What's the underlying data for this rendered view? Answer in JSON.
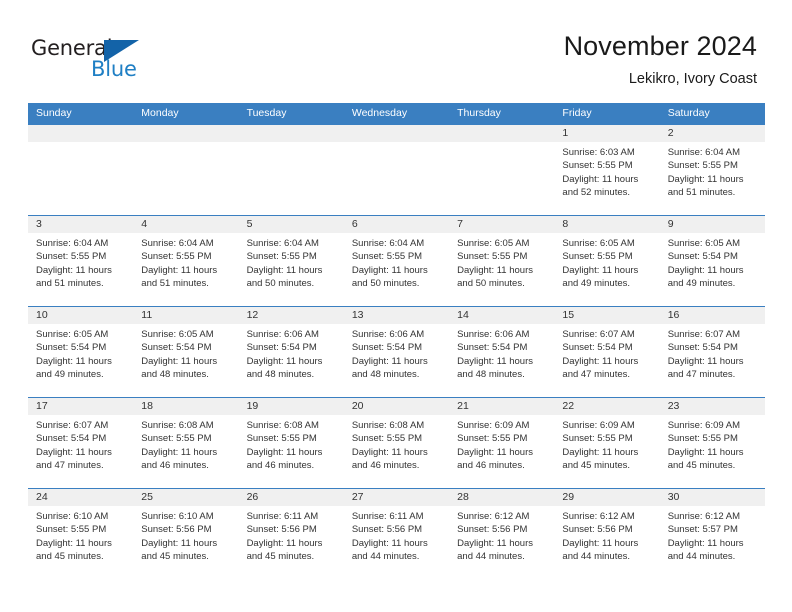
{
  "logo": {
    "word1": "General",
    "word2": "Blue",
    "triangle_color": "#1363a8",
    "blue": "#1f7fc4"
  },
  "header": {
    "title": "November 2024",
    "subtitle": "Lekikro, Ivory Coast"
  },
  "theme": {
    "header_blue": "#3a7fc1",
    "datebar_gray": "#f0f0f0",
    "text": "#333333"
  },
  "weekdays": [
    "Sunday",
    "Monday",
    "Tuesday",
    "Wednesday",
    "Thursday",
    "Friday",
    "Saturday"
  ],
  "weeks": [
    [
      {
        "day": "",
        "sunrise": "",
        "sunset": "",
        "daylight1": "",
        "daylight2": ""
      },
      {
        "day": "",
        "sunrise": "",
        "sunset": "",
        "daylight1": "",
        "daylight2": ""
      },
      {
        "day": "",
        "sunrise": "",
        "sunset": "",
        "daylight1": "",
        "daylight2": ""
      },
      {
        "day": "",
        "sunrise": "",
        "sunset": "",
        "daylight1": "",
        "daylight2": ""
      },
      {
        "day": "",
        "sunrise": "",
        "sunset": "",
        "daylight1": "",
        "daylight2": ""
      },
      {
        "day": "1",
        "sunrise": "Sunrise: 6:03 AM",
        "sunset": "Sunset: 5:55 PM",
        "daylight1": "Daylight: 11 hours",
        "daylight2": "and 52 minutes."
      },
      {
        "day": "2",
        "sunrise": "Sunrise: 6:04 AM",
        "sunset": "Sunset: 5:55 PM",
        "daylight1": "Daylight: 11 hours",
        "daylight2": "and 51 minutes."
      }
    ],
    [
      {
        "day": "3",
        "sunrise": "Sunrise: 6:04 AM",
        "sunset": "Sunset: 5:55 PM",
        "daylight1": "Daylight: 11 hours",
        "daylight2": "and 51 minutes."
      },
      {
        "day": "4",
        "sunrise": "Sunrise: 6:04 AM",
        "sunset": "Sunset: 5:55 PM",
        "daylight1": "Daylight: 11 hours",
        "daylight2": "and 51 minutes."
      },
      {
        "day": "5",
        "sunrise": "Sunrise: 6:04 AM",
        "sunset": "Sunset: 5:55 PM",
        "daylight1": "Daylight: 11 hours",
        "daylight2": "and 50 minutes."
      },
      {
        "day": "6",
        "sunrise": "Sunrise: 6:04 AM",
        "sunset": "Sunset: 5:55 PM",
        "daylight1": "Daylight: 11 hours",
        "daylight2": "and 50 minutes."
      },
      {
        "day": "7",
        "sunrise": "Sunrise: 6:05 AM",
        "sunset": "Sunset: 5:55 PM",
        "daylight1": "Daylight: 11 hours",
        "daylight2": "and 50 minutes."
      },
      {
        "day": "8",
        "sunrise": "Sunrise: 6:05 AM",
        "sunset": "Sunset: 5:55 PM",
        "daylight1": "Daylight: 11 hours",
        "daylight2": "and 49 minutes."
      },
      {
        "day": "9",
        "sunrise": "Sunrise: 6:05 AM",
        "sunset": "Sunset: 5:54 PM",
        "daylight1": "Daylight: 11 hours",
        "daylight2": "and 49 minutes."
      }
    ],
    [
      {
        "day": "10",
        "sunrise": "Sunrise: 6:05 AM",
        "sunset": "Sunset: 5:54 PM",
        "daylight1": "Daylight: 11 hours",
        "daylight2": "and 49 minutes."
      },
      {
        "day": "11",
        "sunrise": "Sunrise: 6:05 AM",
        "sunset": "Sunset: 5:54 PM",
        "daylight1": "Daylight: 11 hours",
        "daylight2": "and 48 minutes."
      },
      {
        "day": "12",
        "sunrise": "Sunrise: 6:06 AM",
        "sunset": "Sunset: 5:54 PM",
        "daylight1": "Daylight: 11 hours",
        "daylight2": "and 48 minutes."
      },
      {
        "day": "13",
        "sunrise": "Sunrise: 6:06 AM",
        "sunset": "Sunset: 5:54 PM",
        "daylight1": "Daylight: 11 hours",
        "daylight2": "and 48 minutes."
      },
      {
        "day": "14",
        "sunrise": "Sunrise: 6:06 AM",
        "sunset": "Sunset: 5:54 PM",
        "daylight1": "Daylight: 11 hours",
        "daylight2": "and 48 minutes."
      },
      {
        "day": "15",
        "sunrise": "Sunrise: 6:07 AM",
        "sunset": "Sunset: 5:54 PM",
        "daylight1": "Daylight: 11 hours",
        "daylight2": "and 47 minutes."
      },
      {
        "day": "16",
        "sunrise": "Sunrise: 6:07 AM",
        "sunset": "Sunset: 5:54 PM",
        "daylight1": "Daylight: 11 hours",
        "daylight2": "and 47 minutes."
      }
    ],
    [
      {
        "day": "17",
        "sunrise": "Sunrise: 6:07 AM",
        "sunset": "Sunset: 5:54 PM",
        "daylight1": "Daylight: 11 hours",
        "daylight2": "and 47 minutes."
      },
      {
        "day": "18",
        "sunrise": "Sunrise: 6:08 AM",
        "sunset": "Sunset: 5:55 PM",
        "daylight1": "Daylight: 11 hours",
        "daylight2": "and 46 minutes."
      },
      {
        "day": "19",
        "sunrise": "Sunrise: 6:08 AM",
        "sunset": "Sunset: 5:55 PM",
        "daylight1": "Daylight: 11 hours",
        "daylight2": "and 46 minutes."
      },
      {
        "day": "20",
        "sunrise": "Sunrise: 6:08 AM",
        "sunset": "Sunset: 5:55 PM",
        "daylight1": "Daylight: 11 hours",
        "daylight2": "and 46 minutes."
      },
      {
        "day": "21",
        "sunrise": "Sunrise: 6:09 AM",
        "sunset": "Sunset: 5:55 PM",
        "daylight1": "Daylight: 11 hours",
        "daylight2": "and 46 minutes."
      },
      {
        "day": "22",
        "sunrise": "Sunrise: 6:09 AM",
        "sunset": "Sunset: 5:55 PM",
        "daylight1": "Daylight: 11 hours",
        "daylight2": "and 45 minutes."
      },
      {
        "day": "23",
        "sunrise": "Sunrise: 6:09 AM",
        "sunset": "Sunset: 5:55 PM",
        "daylight1": "Daylight: 11 hours",
        "daylight2": "and 45 minutes."
      }
    ],
    [
      {
        "day": "24",
        "sunrise": "Sunrise: 6:10 AM",
        "sunset": "Sunset: 5:55 PM",
        "daylight1": "Daylight: 11 hours",
        "daylight2": "and 45 minutes."
      },
      {
        "day": "25",
        "sunrise": "Sunrise: 6:10 AM",
        "sunset": "Sunset: 5:56 PM",
        "daylight1": "Daylight: 11 hours",
        "daylight2": "and 45 minutes."
      },
      {
        "day": "26",
        "sunrise": "Sunrise: 6:11 AM",
        "sunset": "Sunset: 5:56 PM",
        "daylight1": "Daylight: 11 hours",
        "daylight2": "and 45 minutes."
      },
      {
        "day": "27",
        "sunrise": "Sunrise: 6:11 AM",
        "sunset": "Sunset: 5:56 PM",
        "daylight1": "Daylight: 11 hours",
        "daylight2": "and 44 minutes."
      },
      {
        "day": "28",
        "sunrise": "Sunrise: 6:12 AM",
        "sunset": "Sunset: 5:56 PM",
        "daylight1": "Daylight: 11 hours",
        "daylight2": "and 44 minutes."
      },
      {
        "day": "29",
        "sunrise": "Sunrise: 6:12 AM",
        "sunset": "Sunset: 5:56 PM",
        "daylight1": "Daylight: 11 hours",
        "daylight2": "and 44 minutes."
      },
      {
        "day": "30",
        "sunrise": "Sunrise: 6:12 AM",
        "sunset": "Sunset: 5:57 PM",
        "daylight1": "Daylight: 11 hours",
        "daylight2": "and 44 minutes."
      }
    ]
  ]
}
